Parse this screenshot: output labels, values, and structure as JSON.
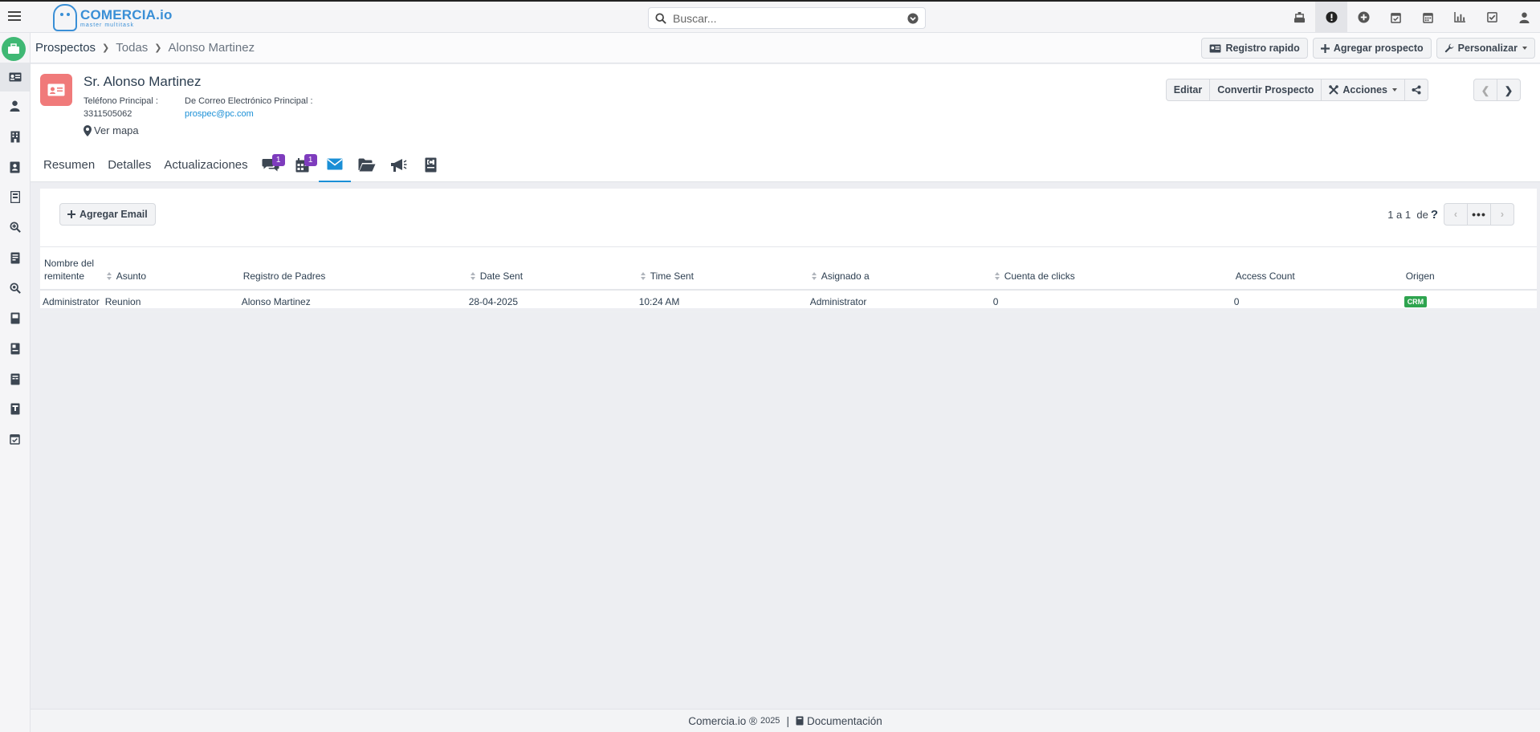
{
  "app": {
    "logo_text": "COMERCIA.io",
    "logo_tagline": "master multitask"
  },
  "search": {
    "placeholder": "Buscar..."
  },
  "top_icons": [
    "cash-register-icon",
    "alert-icon",
    "plus-circle-icon",
    "calendar-check-icon",
    "calendar-icon",
    "bar-chart-icon",
    "check-square-icon",
    "user-icon"
  ],
  "breadcrumb": {
    "module": "Prospectos",
    "view": "Todas",
    "record": "Alonso Martinez"
  },
  "toolbar": {
    "quick_create": "Registro rapido",
    "add_prospect": "Agregar prospecto",
    "customize": "Personalizar"
  },
  "record": {
    "title": "Sr. Alonso Martinez",
    "phone_label": "Teléfono Principal :",
    "phone_value": "3311505062",
    "email_label": "De Correo Electrónico Principal :",
    "email_value": "prospec@pc.com",
    "map_link": "Ver mapa",
    "actions": {
      "edit": "Editar",
      "convert": "Convertir Prospecto",
      "actions": "Acciones"
    }
  },
  "tabs": {
    "summary": "Resumen",
    "details": "Detalles",
    "updates": "Actualizaciones",
    "comments_badge": "1",
    "calendar_badge": "1"
  },
  "emails": {
    "add_button": "Agregar Email",
    "pager_text": "1 a 1  de",
    "pager_more": "•••",
    "columns": {
      "sender": "Nombre del remitente",
      "subject": "Asunto",
      "parent": "Registro de Padres",
      "date_sent": "Date Sent",
      "time_sent": "Time Sent",
      "assigned": "Asignado a",
      "click_count": "Cuenta de clicks",
      "access_count": "Access Count",
      "origin": "Origen"
    },
    "rows": [
      {
        "sender": "Administrator",
        "subject": "Reunion",
        "parent": "Alonso Martinez",
        "date_sent": "28-04-2025",
        "time_sent": "10:24 AM",
        "assigned": "Administrator",
        "click_count": "0",
        "access_count": "0",
        "origin": "CRM"
      }
    ]
  },
  "footer": {
    "brand": "Comercia.io ®",
    "year": "2025",
    "docs": "Documentación"
  },
  "colors": {
    "accent": "#1a8fd6",
    "badge": "#7e3cbd",
    "record_icon": "#f07a7a",
    "crm_tag": "#2ea44f",
    "app_icon": "#3fb874"
  }
}
